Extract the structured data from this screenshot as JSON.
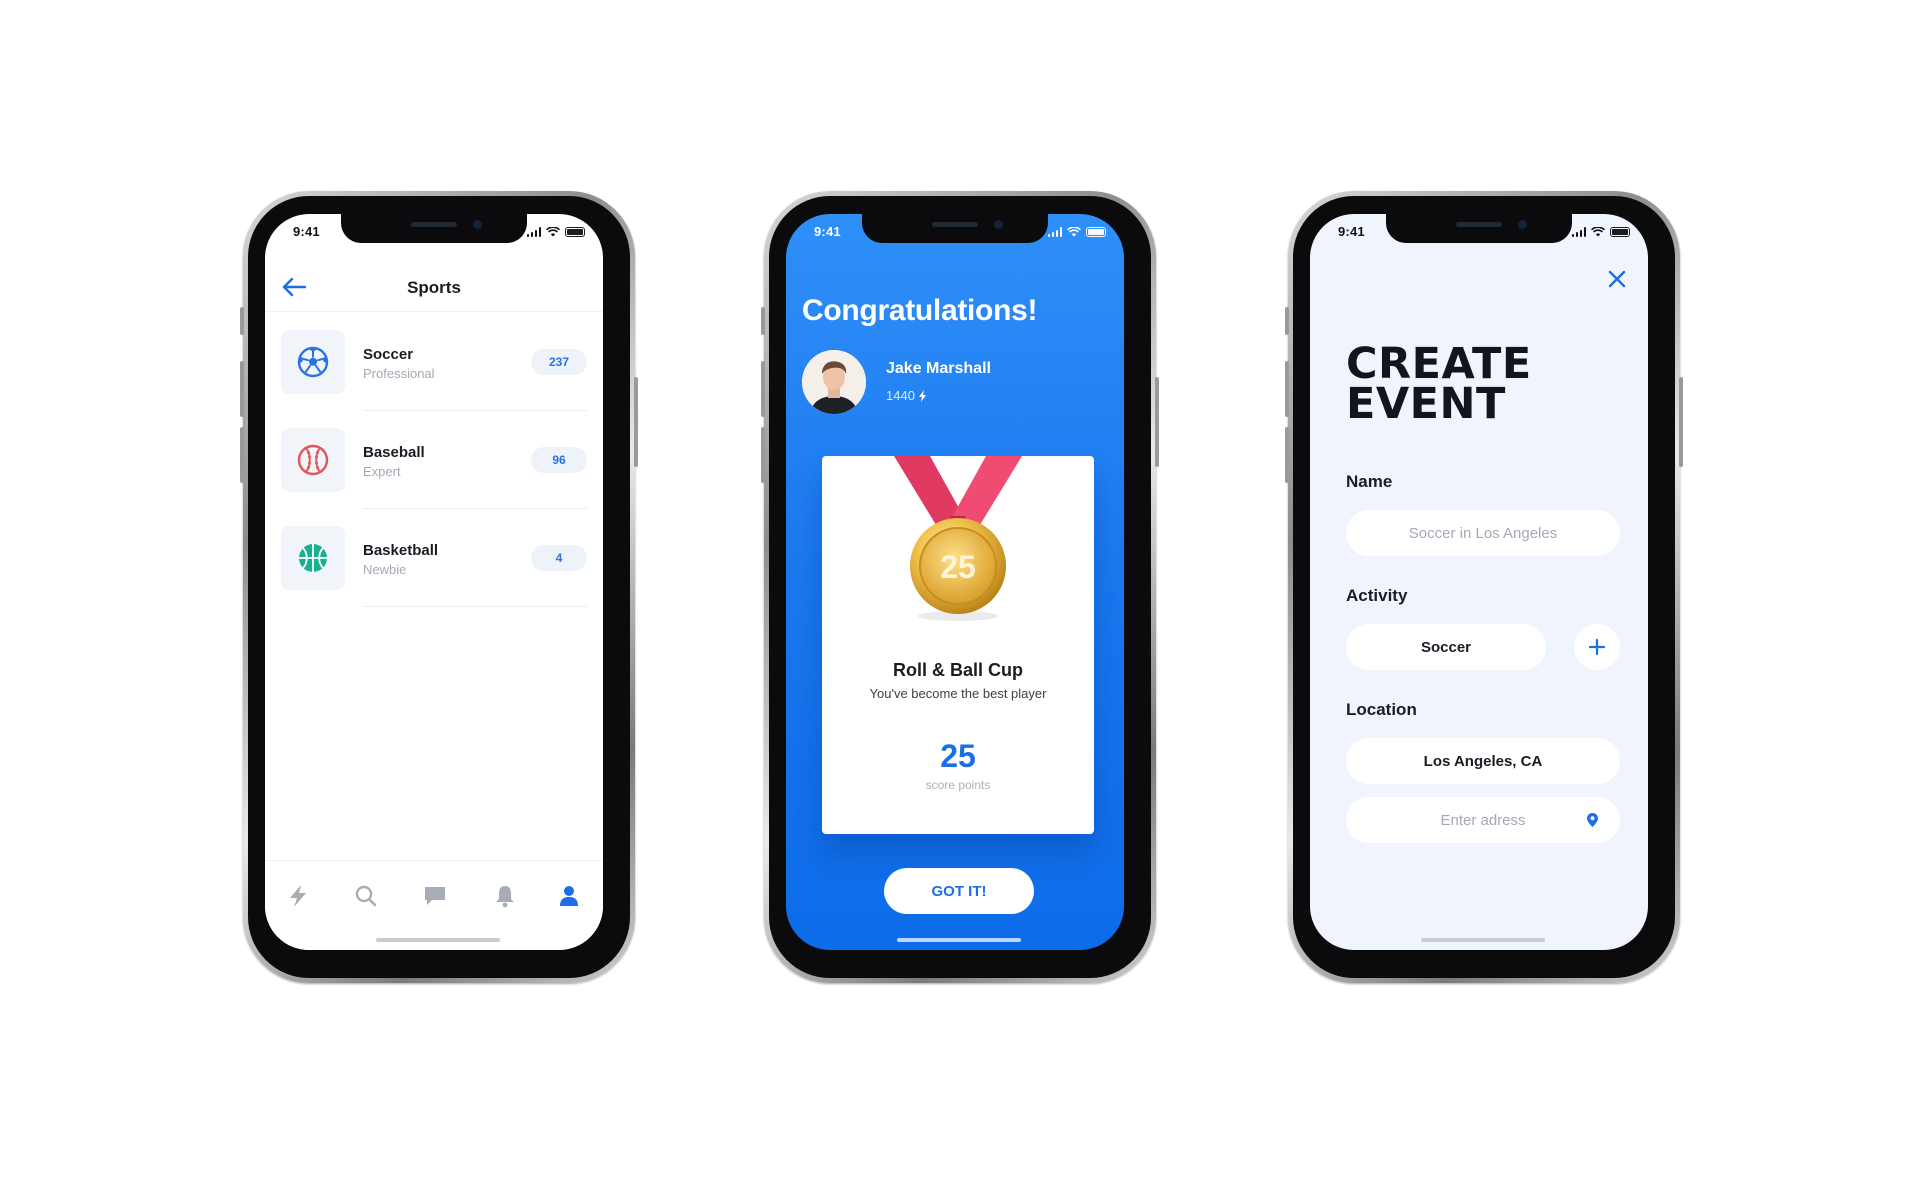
{
  "screens": {
    "sports": {
      "status_time": "9:41",
      "title": "Sports",
      "items": [
        {
          "name": "Soccer",
          "level": "Professional",
          "count": "237",
          "icon": "soccer-ball-icon",
          "color": "#2a72e6"
        },
        {
          "name": "Baseball",
          "level": "Expert",
          "count": "96",
          "icon": "baseball-icon",
          "color": "#e2555a"
        },
        {
          "name": "Basketball",
          "level": "Newbie",
          "count": "4",
          "icon": "basketball-icon",
          "color": "#18b08f"
        }
      ],
      "tabs": [
        "lightning-icon",
        "search-icon",
        "chat-icon",
        "bell-icon",
        "profile-icon"
      ],
      "active_tab": "profile-icon"
    },
    "congrats": {
      "status_time": "9:41",
      "title": "Congratulations!",
      "user_name": "Jake Marshall",
      "user_points": "1440",
      "medal_number": "25",
      "award_title": "Roll & Ball Cup",
      "award_subtitle": "You've become the best player",
      "score": "25",
      "score_label": "score points",
      "button_label": "GOT IT!"
    },
    "create_event": {
      "status_time": "9:41",
      "title_line1": "CREATE",
      "title_line2": "EVENT",
      "name_label": "Name",
      "name_placeholder": "Soccer in Los Angeles",
      "activity_label": "Activity",
      "activity_value": "Soccer",
      "location_label": "Location",
      "location_value": "Los Angeles, CA",
      "address_placeholder": "Enter adress"
    }
  },
  "colors": {
    "accent": "#1b6fe6",
    "gradient_top": "#2f8ff7",
    "gradient_bottom": "#0d6ce8",
    "soft_bg": "#f0f5fd",
    "muted_text": "#a3a9b5"
  }
}
